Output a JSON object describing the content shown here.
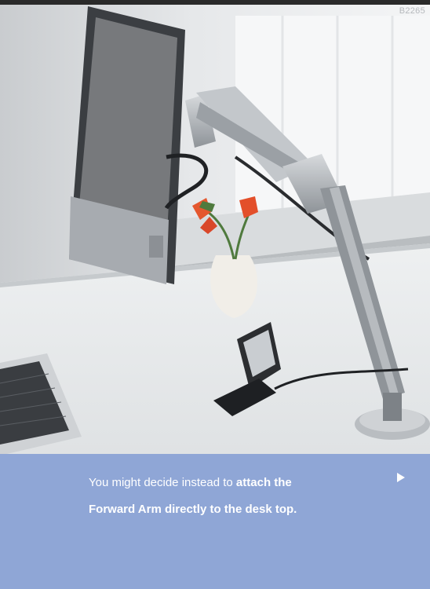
{
  "photo": {
    "code": "B2265"
  },
  "caption": {
    "part1": "You might decide instead to ",
    "bold1": "attach the",
    "bold2": "Forward Arm directly to the desk top."
  },
  "nav": {
    "next_icon": "play-arrow-icon"
  },
  "colors": {
    "panel": "#8fa6d6",
    "caption_text": "#ffffff"
  }
}
